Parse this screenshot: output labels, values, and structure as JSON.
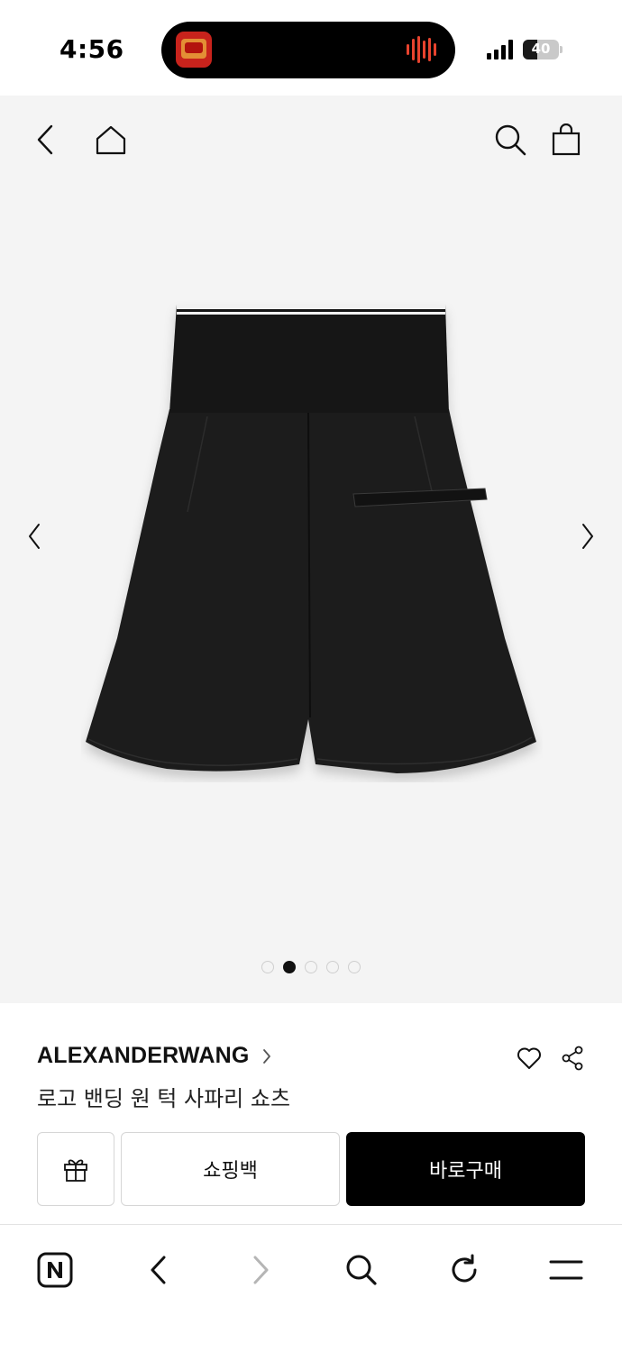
{
  "status_bar": {
    "time": "4:56",
    "battery_percent": "40",
    "battery_level": 0.4,
    "live_activity_icon": "tv-app-icon",
    "audio_indicator_color": "#e8432e"
  },
  "top_nav": {
    "icons": [
      "back-chevron-icon",
      "home-icon",
      "search-icon",
      "shopping-bag-icon"
    ]
  },
  "gallery": {
    "total_images": 5,
    "active_index": 1,
    "background": "#f4f4f4"
  },
  "product": {
    "brand": "ALEXANDERWANG",
    "name": "로고 밴딩 원 턱 사파리 쇼츠"
  },
  "actions": {
    "gift_icon": "gift-icon",
    "cart_label": "쇼핑백",
    "buy_label": "바로구매"
  },
  "browser_toolbar": {
    "icons": [
      "naver-n-icon",
      "back-icon",
      "forward-icon",
      "search-icon",
      "reload-icon",
      "menu-icon"
    ]
  }
}
